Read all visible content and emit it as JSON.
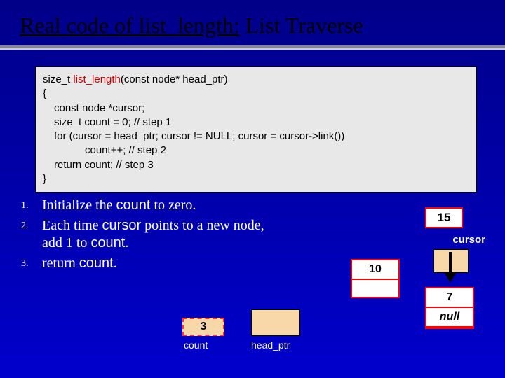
{
  "title": {
    "underlined": "Real code of list_length:",
    "rest": " List Traverse"
  },
  "code": {
    "sig_pre": "size_t ",
    "sig_fn": "list_length",
    "sig_post": "(const node* head_ptr)",
    "open": "{",
    "l1": "const node *cursor;",
    "l2": "size_t count = 0;  // step 1",
    "l3": "for (cursor = head_ptr; cursor != NULL; cursor = cursor->link())",
    "l4": "count++;  // step 2",
    "l5": "return count;  // step 3",
    "close": "}"
  },
  "steps": {
    "n1": "1.",
    "n2": "2.",
    "n3": "3.",
    "s1a": "Initialize the ",
    "s1b": "count",
    "s1c": " to zero.",
    "s2a": "Each time ",
    "s2b": "cursor",
    "s2c": " points to a new node, add 1 to ",
    "s2d": "count",
    "s2e": ".",
    "s3a": "return ",
    "s3b": "count",
    "s3c": "."
  },
  "labels": {
    "count": "count",
    "head_ptr": "head_ptr",
    "cursor": "cursor"
  },
  "values": {
    "count_box": "3",
    "badge15": "15",
    "node10": "10",
    "node7": "7",
    "null": "null"
  }
}
